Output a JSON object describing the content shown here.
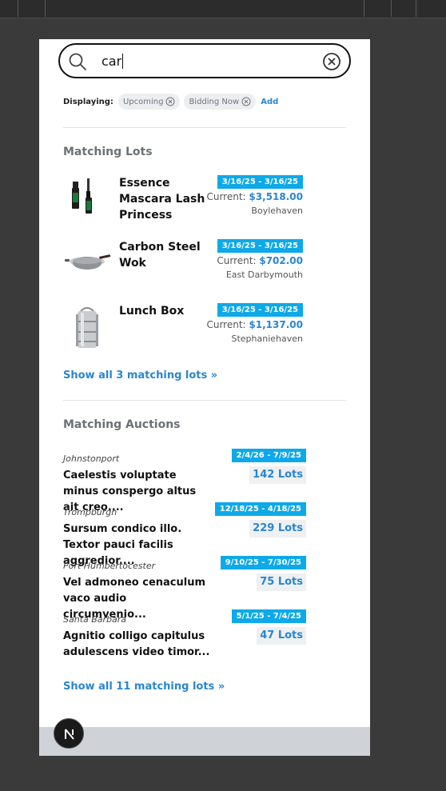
{
  "search": {
    "value": "car"
  },
  "filters": {
    "displaying_label": "Displaying:",
    "chips": [
      "Upcoming",
      "Bidding Now"
    ],
    "add_label": "Add"
  },
  "matching_lots": {
    "title": "Matching Lots",
    "items": [
      {
        "name": "Essence Mascara Lash Princess",
        "date": "3/16/25 - 3/16/25",
        "current_label": "Current:",
        "price": "$3,518.00",
        "location": "Boylehaven",
        "image": "mascara"
      },
      {
        "name": "Carbon Steel Wok",
        "date": "3/16/25 - 3/16/25",
        "current_label": "Current:",
        "price": "$702.00",
        "location": "East Darbymouth",
        "image": "wok"
      },
      {
        "name": "Lunch Box",
        "date": "3/16/25 - 3/16/25",
        "current_label": "Current:",
        "price": "$1,137.00",
        "location": "Stephaniehaven",
        "image": "lunch-box"
      }
    ],
    "show_all": "Show all 3 matching lots »"
  },
  "matching_auctions": {
    "title": "Matching Auctions",
    "items": [
      {
        "city": "Johnstonport",
        "name": "Caelestis voluptate minus conspergo altus ait creo....",
        "date": "2/4/26 - 7/9/25",
        "lots": "142 Lots"
      },
      {
        "city": "Trompburgh",
        "name": "Sursum condico illo. Textor pauci facilis aggredior....",
        "date": "12/18/25 - 4/18/25",
        "lots": "229 Lots"
      },
      {
        "city": "Port Humbertocester",
        "name": "Vel admoneo cenaculum vaco audio circumvenio...",
        "date": "9/10/25 - 7/30/25",
        "lots": "75 Lots"
      },
      {
        "city": "Santa Barbara",
        "name": "Agnitio colligo capitulus adulescens video timor...",
        "date": "5/1/25 - 7/4/25",
        "lots": "47 Lots"
      }
    ],
    "show_all": "Show all 11 matching lots »"
  },
  "colors": {
    "accent": "#2a86d0",
    "date_badge": "#0da9e9"
  }
}
